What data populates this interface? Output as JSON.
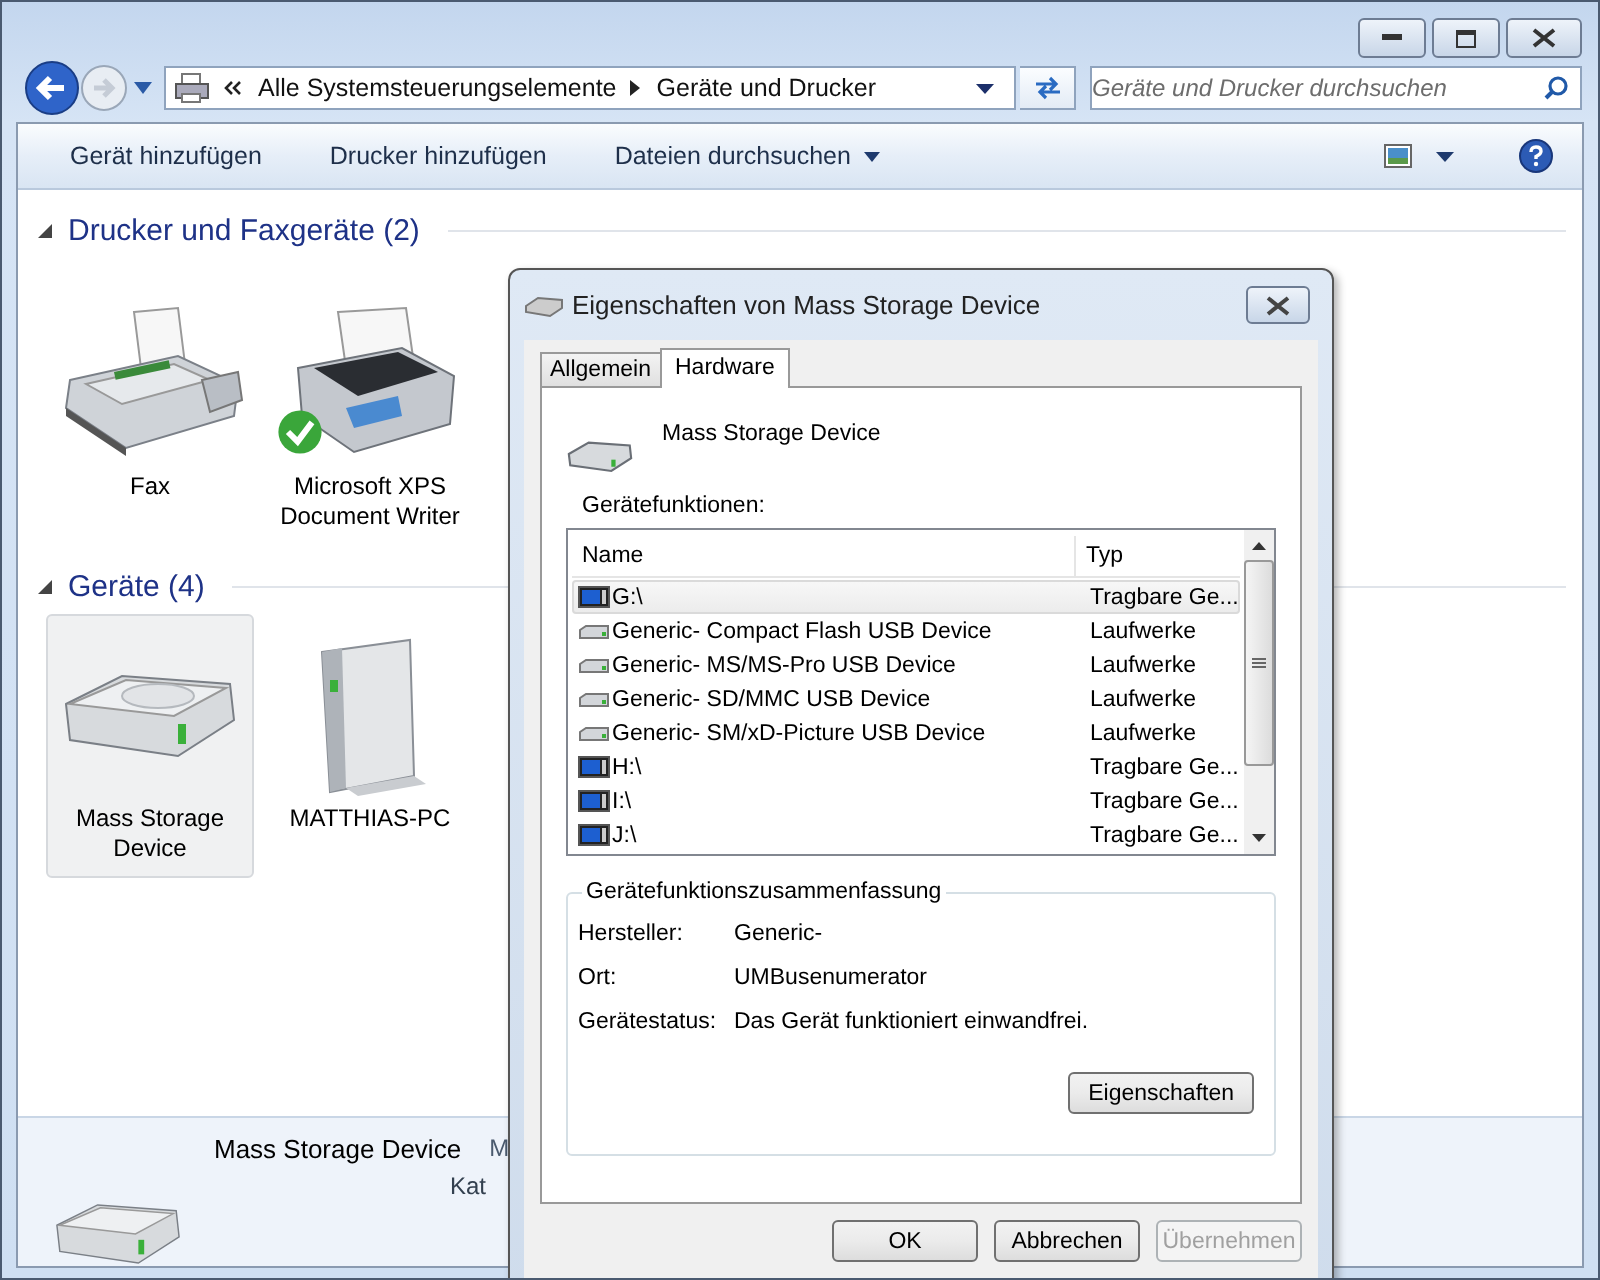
{
  "address": {
    "path": [
      "Alle Systemsteuerungselemente",
      "Geräte und Drucker"
    ]
  },
  "search": {
    "placeholder": "Geräte und Drucker durchsuchen"
  },
  "commands": [
    {
      "label": "Gerät hinzufügen",
      "dropdown": false
    },
    {
      "label": "Drucker hinzufügen",
      "dropdown": false
    },
    {
      "label": "Dateien durchsuchen",
      "dropdown": true
    }
  ],
  "groups": [
    {
      "title": "Drucker und Faxgeräte (2)",
      "expanded": true,
      "items": [
        {
          "label": "Fax",
          "kind": "fax",
          "default": false,
          "selected": false
        },
        {
          "label": "Microsoft XPS Document Writer",
          "kind": "printer",
          "default": true,
          "selected": false
        }
      ]
    },
    {
      "title": "Geräte (4)",
      "expanded": true,
      "items": [
        {
          "label": "Mass Storage Device",
          "kind": "drive",
          "default": false,
          "selected": true
        },
        {
          "label": "MATTHIAS-PC",
          "kind": "computer",
          "default": false,
          "selected": false
        }
      ]
    }
  ],
  "details": {
    "name": "Mass Storage Device",
    "line_1": "M",
    "line_2": "Kat"
  },
  "dialog": {
    "title": "Eigenschaften von Mass Storage Device",
    "tabs": [
      {
        "label": "Allgemein",
        "selected": false
      },
      {
        "label": "Hardware",
        "selected": true
      }
    ],
    "device_name": "Mass Storage Device",
    "functions_label": "Gerätefunktionen:",
    "columns": [
      "Name",
      "Typ"
    ],
    "rows": [
      {
        "name": "G:\\",
        "type": "Tragbare Ge...",
        "kind": "portable",
        "selected": true
      },
      {
        "name": "Generic- Compact Flash USB Device",
        "type": "Laufwerke",
        "kind": "drive",
        "selected": false
      },
      {
        "name": "Generic- MS/MS-Pro USB Device",
        "type": "Laufwerke",
        "kind": "drive",
        "selected": false
      },
      {
        "name": "Generic- SD/MMC USB Device",
        "type": "Laufwerke",
        "kind": "drive",
        "selected": false
      },
      {
        "name": "Generic- SM/xD-Picture USB Device",
        "type": "Laufwerke",
        "kind": "drive",
        "selected": false
      },
      {
        "name": "H:\\",
        "type": "Tragbare Ge...",
        "kind": "portable",
        "selected": false
      },
      {
        "name": "I:\\",
        "type": "Tragbare Ge...",
        "kind": "portable",
        "selected": false
      },
      {
        "name": "J:\\",
        "type": "Tragbare Ge...",
        "kind": "portable",
        "selected": false
      }
    ],
    "summary": {
      "title": "Gerätefunktionszusammenfassung",
      "fields": [
        {
          "label": "Hersteller:",
          "value": "Generic-"
        },
        {
          "label": "Ort:",
          "value": "UMBusenumerator"
        },
        {
          "label": "Gerätestatus:",
          "value": "Das Gerät funktioniert einwandfrei."
        }
      ]
    },
    "properties_button": "Eigenschaften",
    "buttons": [
      {
        "label": "OK",
        "disabled": false
      },
      {
        "label": "Abbrechen",
        "disabled": false
      },
      {
        "label": "Übernehmen",
        "disabled": true
      }
    ]
  }
}
